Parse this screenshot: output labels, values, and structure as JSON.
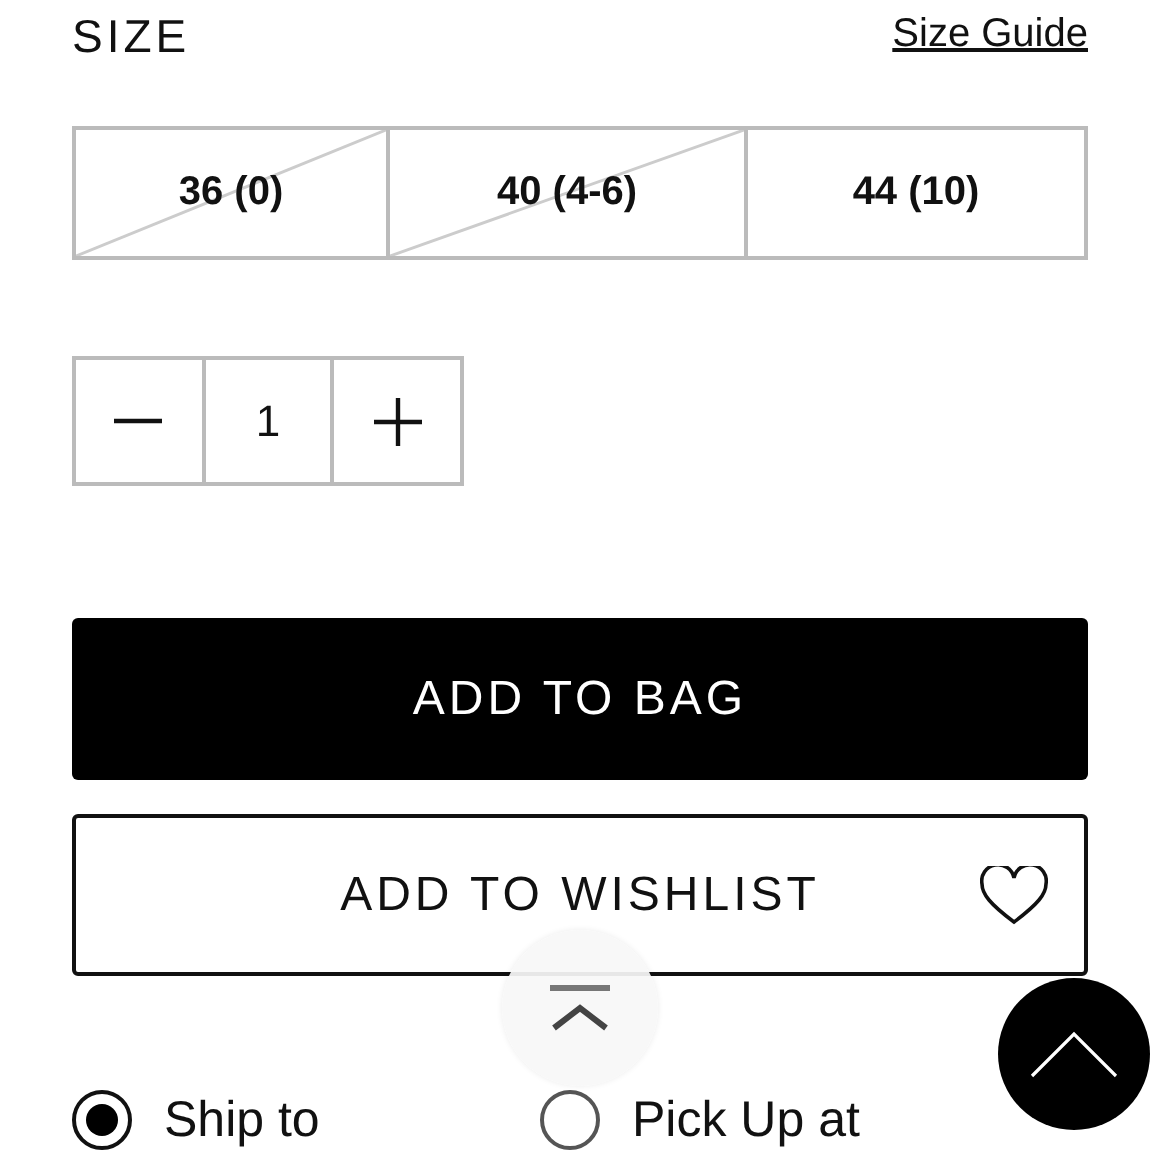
{
  "size_section": {
    "heading": "SIZE",
    "guide_link": "Size Guide"
  },
  "sizes": [
    {
      "label": "36 (0)",
      "available": false
    },
    {
      "label": "40 (4-6)",
      "available": false
    },
    {
      "label": "44 (10)",
      "available": true
    }
  ],
  "quantity": {
    "value": "1"
  },
  "add_to_bag": {
    "label": "ADD TO BAG"
  },
  "add_to_wishlist": {
    "label": "ADD TO WISHLIST"
  },
  "delivery_options": [
    {
      "label": "Ship to",
      "selected": true
    },
    {
      "label": "Pick Up at",
      "selected": false
    }
  ]
}
